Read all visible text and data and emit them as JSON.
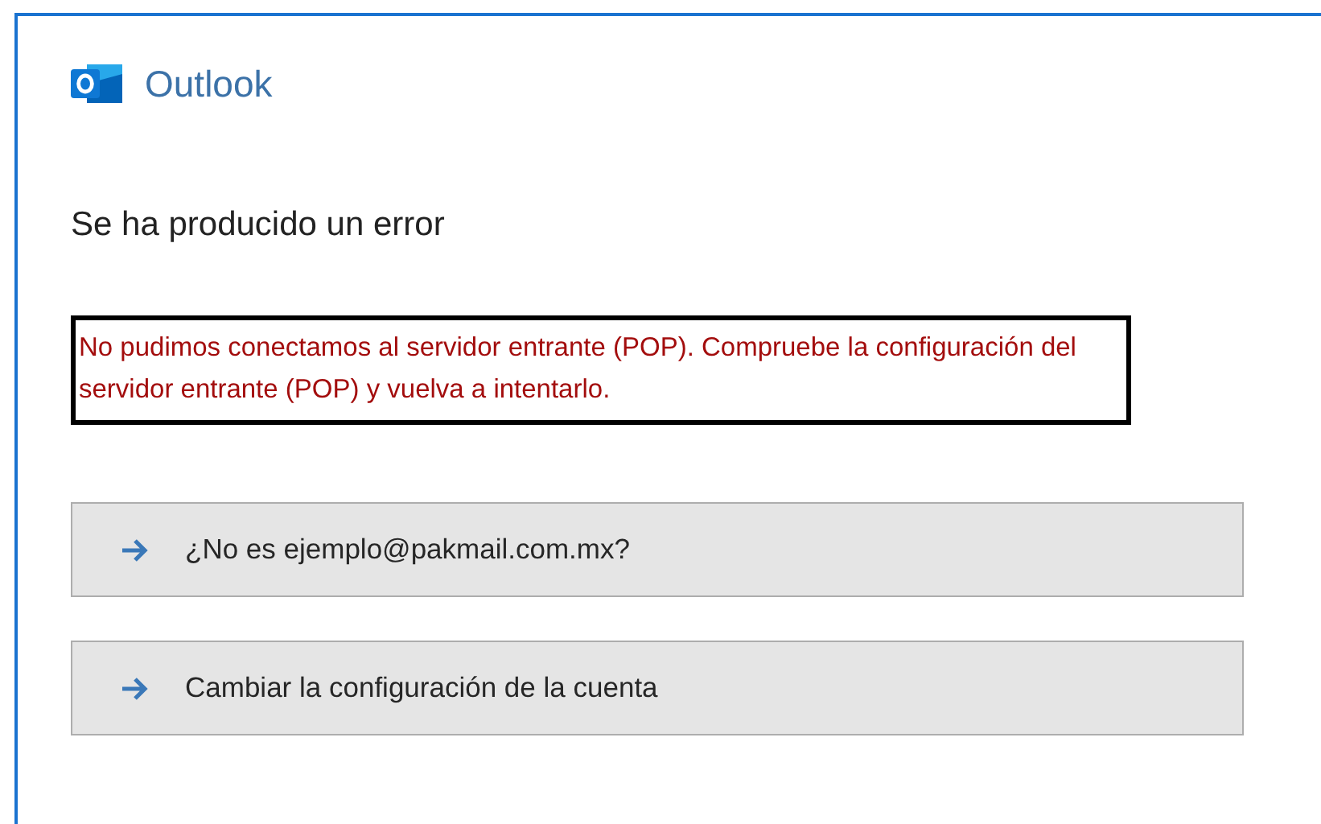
{
  "app": {
    "name": "Outlook"
  },
  "heading": "Se ha producido un error",
  "error_message": "No pudimos conectamos al servidor entrante (POP). Compruebe la configuración del servidor entrante (POP) y vuelva a intentarlo.",
  "buttons": [
    {
      "label": "¿No es ejemplo@pakmail.com.mx?"
    },
    {
      "label": "Cambiar la configuración de la cuenta"
    }
  ]
}
